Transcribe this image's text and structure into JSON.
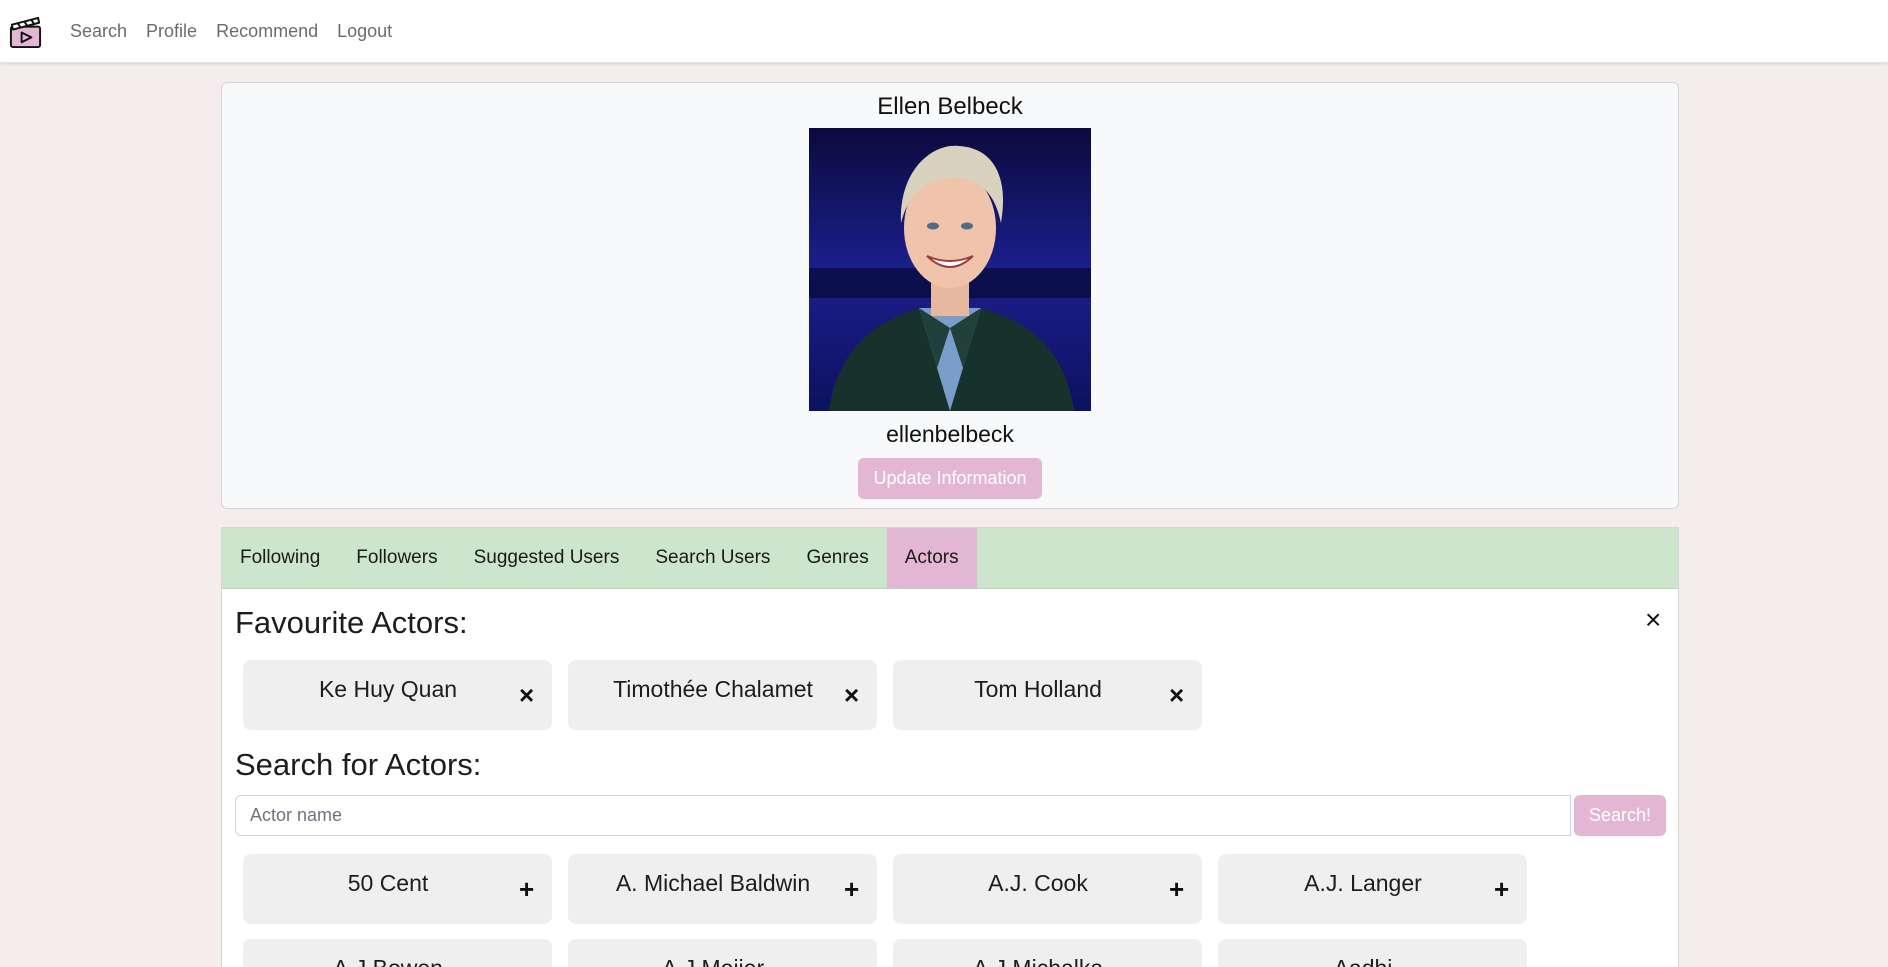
{
  "nav": {
    "logo": "clapperboard-logo",
    "links": [
      "Search",
      "Profile",
      "Recommend",
      "Logout"
    ]
  },
  "profile": {
    "name": "Ellen Belbeck",
    "username": "ellenbelbeck",
    "update_label": "Update Information"
  },
  "tabs": [
    "Following",
    "Followers",
    "Suggested Users",
    "Search Users",
    "Genres",
    "Actors"
  ],
  "active_tab": "Actors",
  "favourites": {
    "title": "Favourite Actors:",
    "close_icon": "×",
    "remove_icon": "×",
    "items": [
      "Ke Huy Quan",
      "Timothée Chalamet",
      "Tom Holland"
    ]
  },
  "search": {
    "title": "Search for Actors:",
    "placeholder": "Actor name",
    "button_label": "Search!",
    "add_icon": "+",
    "results": [
      "50 Cent",
      "A. Michael Baldwin",
      "A.J. Cook",
      "A.J. Langer",
      "A.J Bowen",
      "A.J Meijer",
      "A.J Michalka",
      "Aadhi"
    ]
  },
  "colors": {
    "accent": "#e3b6d3",
    "tab_bar": "#cbe6cc",
    "page_bg": "#f5eded"
  }
}
